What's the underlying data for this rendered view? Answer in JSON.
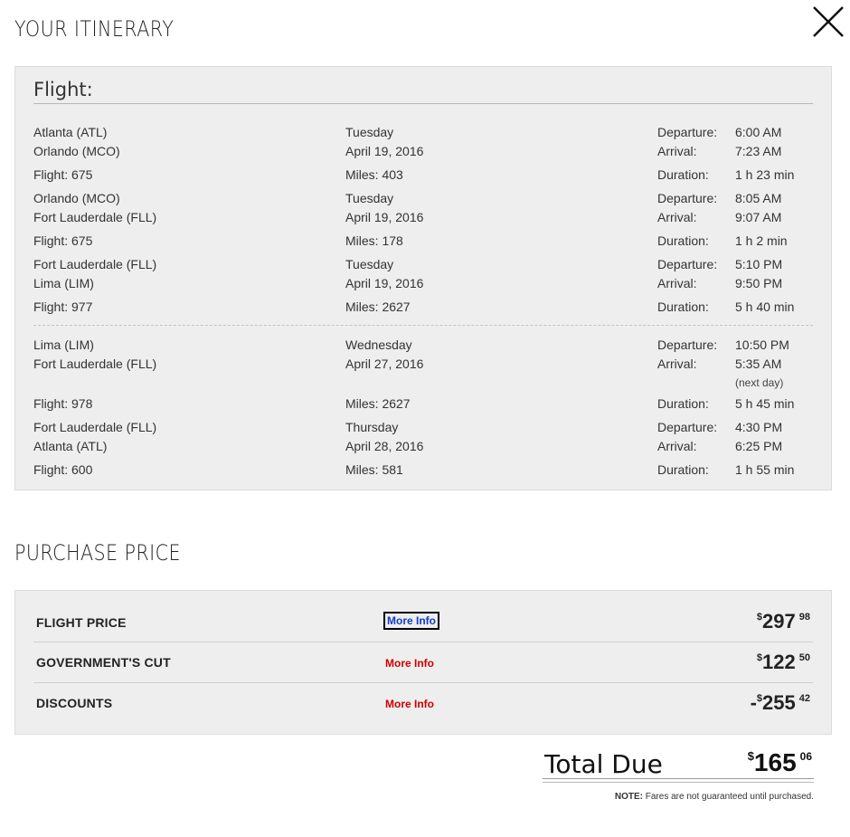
{
  "headings": {
    "itinerary": "YOUR ITINERARY",
    "purchase": "PURCHASE PRICE"
  },
  "flight_panel": {
    "title": "Flight:",
    "outbound": [
      {
        "from": "Atlanta (ATL)",
        "to": "Orlando (MCO)",
        "day": "Tuesday",
        "date": "April 19, 2016",
        "departure_label": "Departure:",
        "departure": "6:00 AM",
        "arrival_label": "Arrival:",
        "arrival": "7:23 AM",
        "flight": "Flight:  675",
        "miles": "Miles: 403",
        "duration_label": "Duration:",
        "duration": "1 h 23 min"
      },
      {
        "from": "Orlando (MCO)",
        "to": "Fort Lauderdale (FLL)",
        "day": "Tuesday",
        "date": "April 19, 2016",
        "departure_label": "Departure:",
        "departure": "8:05 AM",
        "arrival_label": "Arrival:",
        "arrival": "9:07 AM",
        "flight": "Flight:  675",
        "miles": "Miles: 178",
        "duration_label": "Duration:",
        "duration": "1 h 2 min"
      },
      {
        "from": "Fort Lauderdale (FLL)",
        "to": "Lima (LIM)",
        "day": "Tuesday",
        "date": "April 19, 2016",
        "departure_label": "Departure:",
        "departure": "5:10 PM",
        "arrival_label": "Arrival:",
        "arrival": "9:50 PM",
        "flight": "Flight:  977",
        "miles": "Miles: 2627",
        "duration_label": "Duration:",
        "duration": "5 h 40 min"
      }
    ],
    "return": [
      {
        "from": "Lima (LIM)",
        "to": "Fort Lauderdale (FLL)",
        "day": "Wednesday",
        "date": "April 27, 2016",
        "departure_label": "Departure:",
        "departure": "10:50 PM",
        "arrival_label": "Arrival:",
        "arrival": "5:35 AM",
        "arrival_note": "(next day)",
        "flight": "Flight:  978",
        "miles": "Miles: 2627",
        "duration_label": "Duration:",
        "duration": "5 h 45 min"
      },
      {
        "from": "Fort Lauderdale (FLL)",
        "to": "Atlanta (ATL)",
        "day": "Thursday",
        "date": "April 28, 2016",
        "departure_label": "Departure:",
        "departure": "4:30 PM",
        "arrival_label": "Arrival:",
        "arrival": "6:25 PM",
        "flight": "Flight:  600",
        "miles": "Miles: 581",
        "duration_label": "Duration:",
        "duration": "1 h 55 min"
      }
    ]
  },
  "prices": [
    {
      "label": "FLIGHT PRICE",
      "more_info": "More Info",
      "sign": "",
      "currency": "$",
      "dollars": "297",
      "cents": "98"
    },
    {
      "label": "GOVERNMENT'S CUT",
      "more_info": "More Info",
      "sign": "",
      "currency": "$",
      "dollars": "122",
      "cents": "50"
    },
    {
      "label": "DISCOUNTS",
      "more_info": "More Info",
      "sign": "-",
      "currency": "$",
      "dollars": "255",
      "cents": "42"
    }
  ],
  "total": {
    "label": "Total Due",
    "currency": "$",
    "dollars": "165",
    "cents": "06"
  },
  "note": {
    "label": "NOTE:",
    "text": " Fares are not guaranteed until purchased."
  },
  "colors": {
    "panel_bg": "#eeeeee",
    "more_info_active": "#0f3cc9",
    "more_info": "#cc0000"
  },
  "icons": {
    "close": "close-icon"
  }
}
